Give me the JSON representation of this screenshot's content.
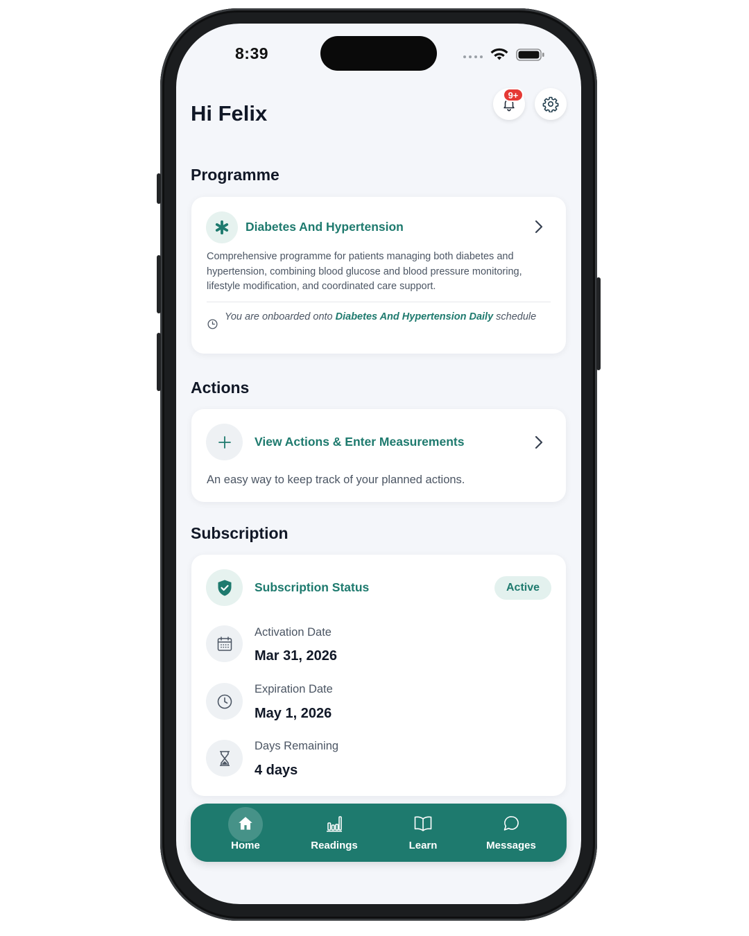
{
  "status_bar": {
    "time": "8:39"
  },
  "header": {
    "greeting": "Hi Felix",
    "notification_badge": "9+"
  },
  "programme": {
    "section_title": "Programme",
    "name": "Diabetes And Hypertension",
    "description": "Comprehensive programme for patients managing both diabetes and hypertension, combining blood glucose and blood pressure monitoring, lifestyle modification, and coordinated care support.",
    "onboard_prefix": "You are onboarded onto",
    "onboard_schedule": "Diabetes And Hypertension Daily",
    "onboard_suffix": "schedule"
  },
  "actions": {
    "section_title": "Actions",
    "title": "View Actions & Enter Measurements",
    "description": "An easy way to keep track of your planned actions."
  },
  "subscription": {
    "section_title": "Subscription",
    "status_label": "Subscription Status",
    "status_value": "Active",
    "activation_label": "Activation Date",
    "activation_value": "Mar 31, 2026",
    "expiration_label": "Expiration Date",
    "expiration_value": "May 1, 2026",
    "remaining_label": "Days Remaining",
    "remaining_value": "4 days"
  },
  "tabbar": {
    "tabs": [
      {
        "label": "Home",
        "icon": "home-icon",
        "active": true
      },
      {
        "label": "Readings",
        "icon": "bar-chart-icon",
        "active": false
      },
      {
        "label": "Learn",
        "icon": "book-icon",
        "active": false
      },
      {
        "label": "Messages",
        "icon": "chat-bubble-icon",
        "active": false
      }
    ]
  },
  "colors": {
    "accent": "#1e7a6e",
    "accent_light": "#e3f1ee",
    "badge": "#e53935",
    "background": "#f4f6fa"
  }
}
